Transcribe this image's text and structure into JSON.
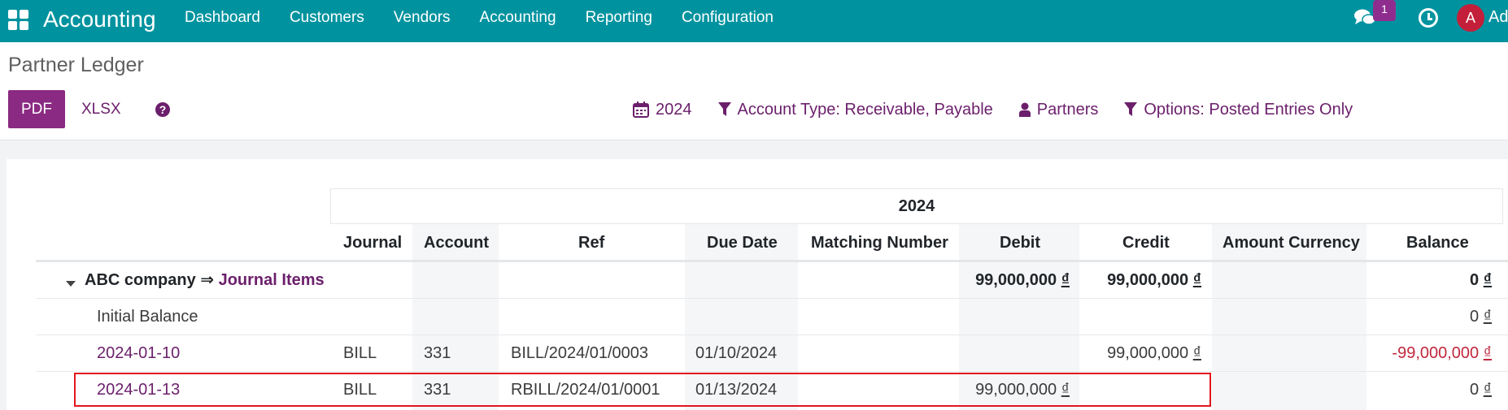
{
  "navbar": {
    "app_name": "Accounting",
    "menu": [
      "Dashboard",
      "Customers",
      "Vendors",
      "Accounting",
      "Reporting",
      "Configuration"
    ],
    "chat_badge": "1",
    "avatar_letter": "A",
    "user_name": "Ad",
    "color": "#00939f"
  },
  "page": {
    "title": "Partner Ledger",
    "buttons": {
      "pdf": "PDF",
      "xlsx": "XLSX"
    },
    "filters": {
      "date": "2024",
      "account_type": "Account Type: Receivable, Payable",
      "partners": "Partners",
      "options": "Options: Posted Entries Only"
    }
  },
  "report": {
    "period": "2024",
    "columns": [
      "Journal",
      "Account",
      "Ref",
      "Due Date",
      "Matching Number",
      "Debit",
      "Credit",
      "Amount Currency",
      "Balance"
    ],
    "group": {
      "name": "ABC company",
      "arrow": "⇒",
      "link": "Journal Items",
      "debit": "99,000,000",
      "credit": "99,000,000",
      "balance": "0"
    },
    "currency_symbol": "₫",
    "rows": [
      {
        "label": "Initial Balance",
        "journal": "",
        "account": "",
        "ref": "",
        "due_date": "",
        "matching": "",
        "debit": "",
        "credit": "",
        "amount_currency": "",
        "balance": "0"
      },
      {
        "label": "2024-01-10",
        "journal": "BILL",
        "account": "331",
        "ref": "BILL/2024/01/0003",
        "due_date": "01/10/2024",
        "matching": "",
        "debit": "",
        "credit": "99,000,000",
        "amount_currency": "",
        "balance": "-99,000,000"
      },
      {
        "label": "2024-01-13",
        "journal": "BILL",
        "account": "331",
        "ref": "RBILL/2024/01/0001",
        "due_date": "01/13/2024",
        "matching": "",
        "debit": "99,000,000",
        "credit": "",
        "amount_currency": "",
        "balance": "0"
      }
    ]
  }
}
